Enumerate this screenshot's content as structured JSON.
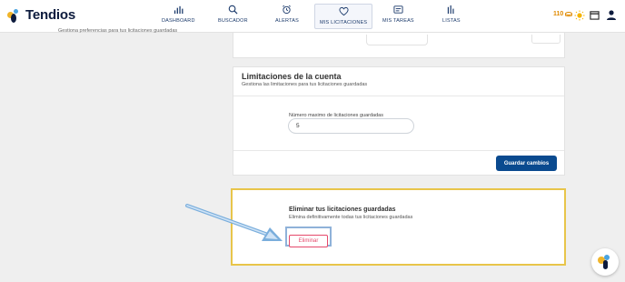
{
  "brand": {
    "name": "Tendios"
  },
  "nav": {
    "dashboard": "DASHBOARD",
    "buscador": "BUSCADOR",
    "alertas": "ALERTAS",
    "mis_licitaciones": "MIS LICITACIONES",
    "mis_tareas": "MIS TAREAS",
    "listas": "LISTAS"
  },
  "header_right": {
    "credits": "110"
  },
  "top_panel": {
    "subtitle_cut": "Gestiona preferencias para tus licitaciones guardadas"
  },
  "limits": {
    "title": "Limitaciones de la cuenta",
    "subtitle": "Gestiona las limitaciones para tus licitaciones guardadas",
    "field_label": "Número maximo de licitaciones guardadas",
    "field_value": "5",
    "save_label": "Guardar cambios"
  },
  "delete_section": {
    "title": "Eliminar tus licitaciones guardadas",
    "subtitle": "Elimina definitivamente todas tus licitaciones guardadas",
    "button_label": "Eliminar"
  },
  "colors": {
    "primary": "#0a4a8f",
    "danger": "#e5496b",
    "highlight": "#e8c54a",
    "credits": "#e08a00"
  },
  "icons": {
    "dashboard": "bar-chart-icon",
    "buscador": "search-icon",
    "alertas": "alarm-clock-icon",
    "mis_licitaciones": "heart-icon",
    "mis_tareas": "task-board-icon",
    "listas": "list-bars-icon"
  }
}
